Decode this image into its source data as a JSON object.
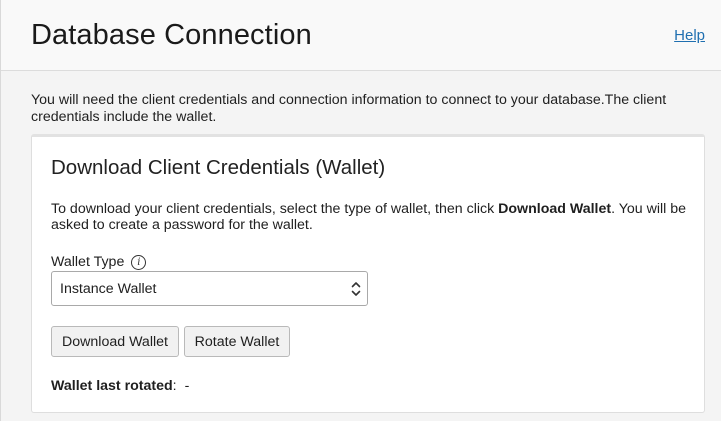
{
  "header": {
    "title": "Database Connection",
    "help_label": "Help"
  },
  "intro_text": "You will need the client credentials and connection information to connect to your database.The client credentials include the wallet.",
  "credentials_card": {
    "title": "Download Client Credentials (Wallet)",
    "description_before": "To download your client credentials, select the type of wallet, then click ",
    "description_bold": "Download Wallet",
    "description_after": ". You will be asked to create a password for the wallet.",
    "wallet_type_label": "Wallet Type",
    "wallet_type_value": "Instance Wallet",
    "download_button": "Download Wallet",
    "rotate_button": "Rotate Wallet",
    "last_rotated_label": "Wallet last rotated",
    "last_rotated_colon": ":",
    "last_rotated_value": "-"
  },
  "icons": {
    "info": "info-icon",
    "select_arrows": "chevron-up-down-icon"
  },
  "colors": {
    "link": "#1f6fb0",
    "background": "#f4f4f4",
    "card": "#ffffff"
  }
}
